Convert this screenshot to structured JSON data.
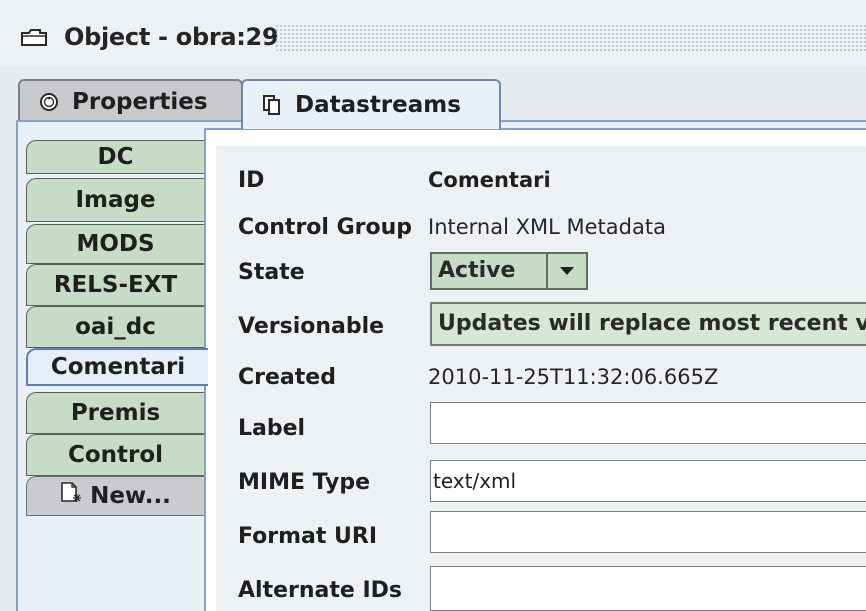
{
  "window": {
    "title": "Object - obra:29",
    "icon": "folder-icon"
  },
  "top_tabs": [
    {
      "label": "Properties",
      "icon": "info-icon",
      "selected": false
    },
    {
      "label": "Datastreams",
      "icon": "datastream-icon",
      "selected": true
    }
  ],
  "datastream_tabs": [
    {
      "label": "DC",
      "selected": false
    },
    {
      "label": "Image",
      "selected": false
    },
    {
      "label": "MODS",
      "selected": false
    },
    {
      "label": "RELS-EXT",
      "selected": false
    },
    {
      "label": "oai_dc",
      "selected": false
    },
    {
      "label": "Comentari",
      "selected": true
    },
    {
      "label": "Premis",
      "selected": false
    },
    {
      "label": "Control",
      "selected": false
    },
    {
      "label": "New...",
      "icon": "new-document-icon",
      "selected": false
    }
  ],
  "details": {
    "id_label": "ID",
    "id_value": "Comentari",
    "control_group_label": "Control Group",
    "control_group_value": "Internal XML Metadata",
    "state_label": "State",
    "state_value": "Active",
    "versionable_label": "Versionable",
    "versionable_value": "Updates will replace most recent v",
    "created_label": "Created",
    "created_value": "2010-11-25T11:32:06.665Z",
    "label_label": "Label",
    "label_value": "",
    "mime_label": "MIME Type",
    "mime_value": "text/xml",
    "format_uri_label": "Format URI",
    "format_uri_value": "",
    "alt_ids_label": "Alternate IDs",
    "alt_ids_value": ""
  },
  "colors": {
    "tab_green": "#c6dcc6",
    "selected_blue": "#e6eff9",
    "panel_bg": "#eef1f4",
    "border_blue": "#8aa2c2"
  }
}
